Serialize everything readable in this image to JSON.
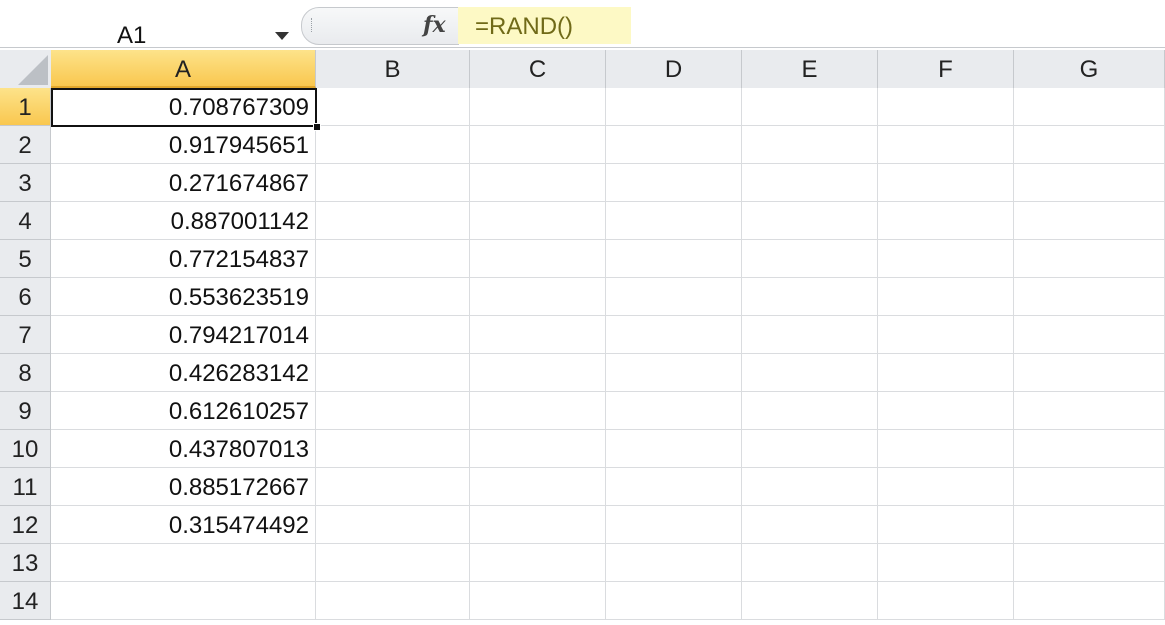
{
  "name_box": {
    "value": "A1"
  },
  "formula_bar": {
    "fx_label": "fx",
    "formula": "=RAND()"
  },
  "columns": [
    "A",
    "B",
    "C",
    "D",
    "E",
    "F",
    "G"
  ],
  "rows": [
    "1",
    "2",
    "3",
    "4",
    "5",
    "6",
    "7",
    "8",
    "9",
    "10",
    "11",
    "12",
    "13",
    "14"
  ],
  "column_a_values": [
    "0.708767309",
    "0.917945651",
    "0.271674867",
    "0.887001142",
    "0.772154837",
    "0.553623519",
    "0.794217014",
    "0.426283142",
    "0.612610257",
    "0.437807013",
    "0.885172667",
    "0.315474492"
  ],
  "selected_cell": "A1"
}
